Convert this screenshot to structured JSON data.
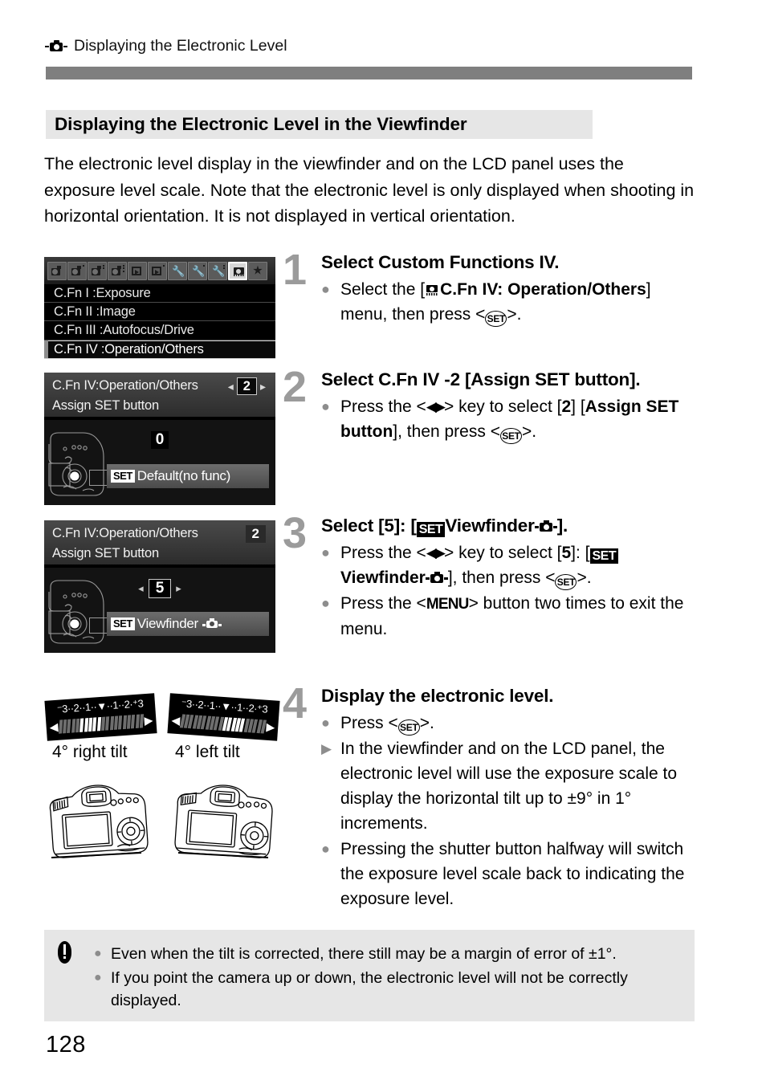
{
  "header": {
    "icon": "camera-icon",
    "title": "Displaying the Electronic Level"
  },
  "section": {
    "title": "Displaying the Electronic Level in the Viewfinder"
  },
  "intro": {
    "text": "The electronic level display in the viewfinder and on the LCD panel uses the exposure level scale. Note that the electronic level is only displayed when shooting in horizontal orientation. It is not displayed in vertical orientation."
  },
  "screens": {
    "menu": {
      "tabs": [
        {
          "name": "shooting-1",
          "type": "camera",
          "dots": 0,
          "active": false
        },
        {
          "name": "shooting-2",
          "type": "camera",
          "dots": 1,
          "active": false
        },
        {
          "name": "shooting-3",
          "type": "camera",
          "dots": 2,
          "active": false
        },
        {
          "name": "shooting-4",
          "type": "camera",
          "dots": 3,
          "active": false
        },
        {
          "name": "playback-1",
          "type": "playback",
          "dots": 0,
          "active": false
        },
        {
          "name": "playback-2",
          "type": "playback",
          "dots": 1,
          "active": false
        },
        {
          "name": "setup-1",
          "type": "wrench",
          "dots": 0,
          "active": false
        },
        {
          "name": "setup-2",
          "type": "wrench",
          "dots": 1,
          "active": false
        },
        {
          "name": "setup-3",
          "type": "wrench",
          "dots": 2,
          "active": false
        },
        {
          "name": "custom-functions",
          "type": "cfn",
          "dots": 0,
          "active": true
        },
        {
          "name": "my-menu",
          "type": "star",
          "dots": 0,
          "active": false
        }
      ],
      "rows": [
        {
          "label": "C.Fn I :Exposure",
          "selected": false
        },
        {
          "label": "C.Fn II :Image",
          "selected": false
        },
        {
          "label": "C.Fn III :Autofocus/Drive",
          "selected": false
        },
        {
          "label": "C.Fn IV :Operation/Others",
          "selected": true
        }
      ]
    },
    "cfn_default": {
      "title": "C.Fn IV:Operation/Others",
      "subtitle": "Assign SET button",
      "header_number": "2",
      "header_number_boxed": true,
      "setting_number": "0",
      "setting_number_boxed": false,
      "option_set_chip": "SET",
      "option_label": "Default(no func)"
    },
    "cfn_viewfinder": {
      "title": "C.Fn IV:Operation/Others",
      "subtitle": "Assign SET button",
      "header_number": "2",
      "header_number_boxed": false,
      "setting_number": "5",
      "setting_number_boxed": true,
      "option_set_chip": "SET",
      "option_label": "Viewfinder"
    }
  },
  "steps": [
    {
      "number": "1",
      "heading": "Select Custom Functions IV.",
      "bullets": [
        {
          "marker": "dot",
          "segments": [
            {
              "t": "Select the [",
              "b": false
            },
            {
              "icon": "cfn-camera-icon"
            },
            {
              "t": "C.Fn IV: Operation/",
              "b": true
            },
            {
              "t": "Others",
              "b": true
            },
            {
              "t": "] menu, then press <",
              "b": false
            },
            {
              "icon": "set-key-icon"
            },
            {
              "t": ">.",
              "b": false
            }
          ]
        }
      ]
    },
    {
      "number": "2",
      "heading": "Select C.Fn IV -2 [Assign SET button].",
      "bullets": [
        {
          "marker": "dot",
          "segments": [
            {
              "t": "Press the <",
              "b": false
            },
            {
              "icon": "left-right-arrow-icon"
            },
            {
              "t": "> key to select [",
              "b": false
            },
            {
              "t": "2",
              "b": true
            },
            {
              "t": "] [",
              "b": false
            },
            {
              "t": "Assign SET button",
              "b": true
            },
            {
              "t": "], then press <",
              "b": false
            },
            {
              "icon": "set-key-icon"
            },
            {
              "t": ">.",
              "b": false
            }
          ]
        }
      ]
    },
    {
      "number": "3",
      "heading": "Select [5]: [SET Viewfinder ].",
      "bullets": [
        {
          "marker": "dot",
          "segments": [
            {
              "t": "Press the <",
              "b": false
            },
            {
              "icon": "left-right-arrow-icon"
            },
            {
              "t": "> key to select [",
              "b": false
            },
            {
              "t": "5",
              "b": true
            },
            {
              "t": "]: [",
              "b": false
            },
            {
              "icon": "set-block-icon"
            },
            {
              "t": "Viewfinder",
              "b": true
            },
            {
              "icon": "camera-icon"
            },
            {
              "t": "], then press <",
              "b": false
            },
            {
              "icon": "set-key-icon"
            },
            {
              "t": ">.",
              "b": false
            }
          ]
        },
        {
          "marker": "dot",
          "segments": [
            {
              "t": "Press the <",
              "b": false
            },
            {
              "icon": "menu-key-icon"
            },
            {
              "t": "> button two times to exit the menu.",
              "b": false
            }
          ]
        }
      ]
    },
    {
      "number": "4",
      "heading": "Display the electronic level.",
      "bullets": [
        {
          "marker": "dot",
          "segments": [
            {
              "t": "Press <",
              "b": false
            },
            {
              "icon": "set-key-icon"
            },
            {
              "t": ">.",
              "b": false
            }
          ]
        },
        {
          "marker": "triangle",
          "segments": [
            {
              "t": "In the viewfinder and on the LCD panel, the electronic level will use the exposure scale to display the horizontal tilt up to ±9° in 1° increments.",
              "b": false
            }
          ]
        },
        {
          "marker": "dot",
          "segments": [
            {
              "t": "Pressing the shutter button halfway will switch the exposure level scale back to indicating the exposure level.",
              "b": false
            }
          ]
        }
      ]
    }
  ],
  "step3_heading_parts": {
    "pre": "Select [5]: [",
    "set_chip": "SET",
    "mid": "Viewfinder",
    "post": "]."
  },
  "step1_bullet_parts": {
    "pre": "Select the [",
    "bold1": "C.Fn IV: Operation/",
    "bold2": "Others",
    "mid": "] menu, then press <",
    "post": ">."
  },
  "step2_bullet_parts": {
    "pre": "Press the <",
    "mid1": "> key to select [",
    "val": "2",
    "mid2": "] [",
    "bold": "Assign SET button",
    "mid3": "], then press <",
    "post": ">."
  },
  "step3_bullet1_parts": {
    "pre": "Press the <",
    "mid1": "> key to select [",
    "val": "5",
    "mid2": "]: [",
    "set_chip": "SET",
    "bold": "Viewfinder",
    "mid3": "], then press <",
    "post": ">."
  },
  "step3_bullet2_parts": {
    "pre": "Press the <",
    "key": "MENU",
    "post": "> button two times to exit the menu."
  },
  "step4_bullet1_parts": {
    "pre": "Press <",
    "post": ">."
  },
  "tilt_displays": [
    {
      "name": "right-tilt",
      "label": "4° right tilt",
      "scale_ticks": "⁻3··2··1··▼··1··2·⁺3",
      "segments": 21,
      "lit_from": 5,
      "lit_to": 9,
      "rotation_deg": -4
    },
    {
      "name": "left-tilt",
      "label": "4° left tilt",
      "scale_ticks": "⁻3··2··1··▼··1··2·⁺3",
      "segments": 21,
      "lit_from": 11,
      "lit_to": 15,
      "rotation_deg": 4
    }
  ],
  "caution": {
    "icon": "warning-icon",
    "items": [
      "Even when the tilt is corrected, there still may be a margin of error of ±1°.",
      "If you point the camera up or down, the electronic level will not be correctly displayed."
    ]
  },
  "page_number": "128",
  "colors": {
    "header_rule": "#7f7f7f",
    "section_bg": "#e6e6e6",
    "step_number": "#9b9b9b",
    "bullet_dot": "#8d8d8d",
    "caution_bg": "#e6e6e6",
    "screen_bg": "#000000"
  }
}
